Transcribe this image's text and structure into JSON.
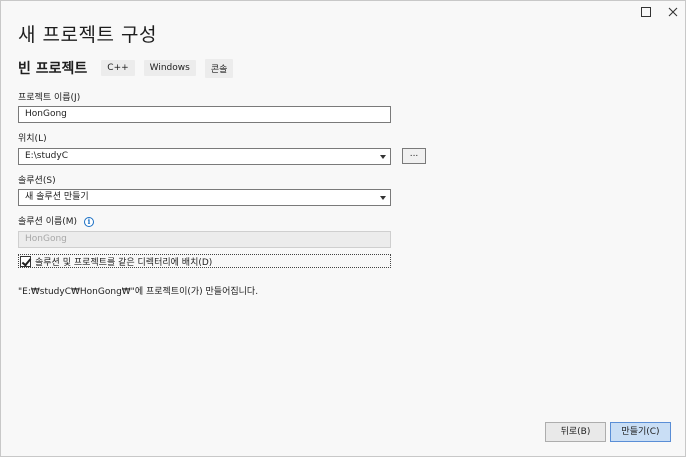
{
  "window": {
    "maximize_glyph": "☐",
    "close_glyph": "✕"
  },
  "page": {
    "title": "새 프로젝트 구성"
  },
  "template": {
    "name": "빈 프로젝트",
    "tags": [
      "C++",
      "Windows",
      "콘솔"
    ]
  },
  "project_name": {
    "label": "프로젝트 이름(J)",
    "value": "HonGong"
  },
  "location": {
    "label": "위치(L)",
    "value": "E:\\studyC",
    "browse_label": "..."
  },
  "solution": {
    "label": "솔루션(S)",
    "value": "새 솔루션 만들기"
  },
  "solution_name": {
    "label": "솔루션 이름(M)",
    "value": "HonGong",
    "info_glyph": "i"
  },
  "same_dir": {
    "label": "솔루션 및 프로젝트를 같은 디렉터리에 배치(D)",
    "checked": true
  },
  "path_note": "\"E:₩studyC₩HonGong₩\"에 프로젝트이(가) 만들어집니다.",
  "footer": {
    "back_label": "뒤로(B)",
    "create_label": "만들기(C)"
  },
  "colors": {
    "accent": "#5a8ed6",
    "info": "#1a6fc4"
  },
  "icons": {
    "maximize": "maximize-icon",
    "close": "close-icon",
    "dropdown": "chevron-down-icon",
    "info": "info-icon",
    "check": "check-icon"
  }
}
